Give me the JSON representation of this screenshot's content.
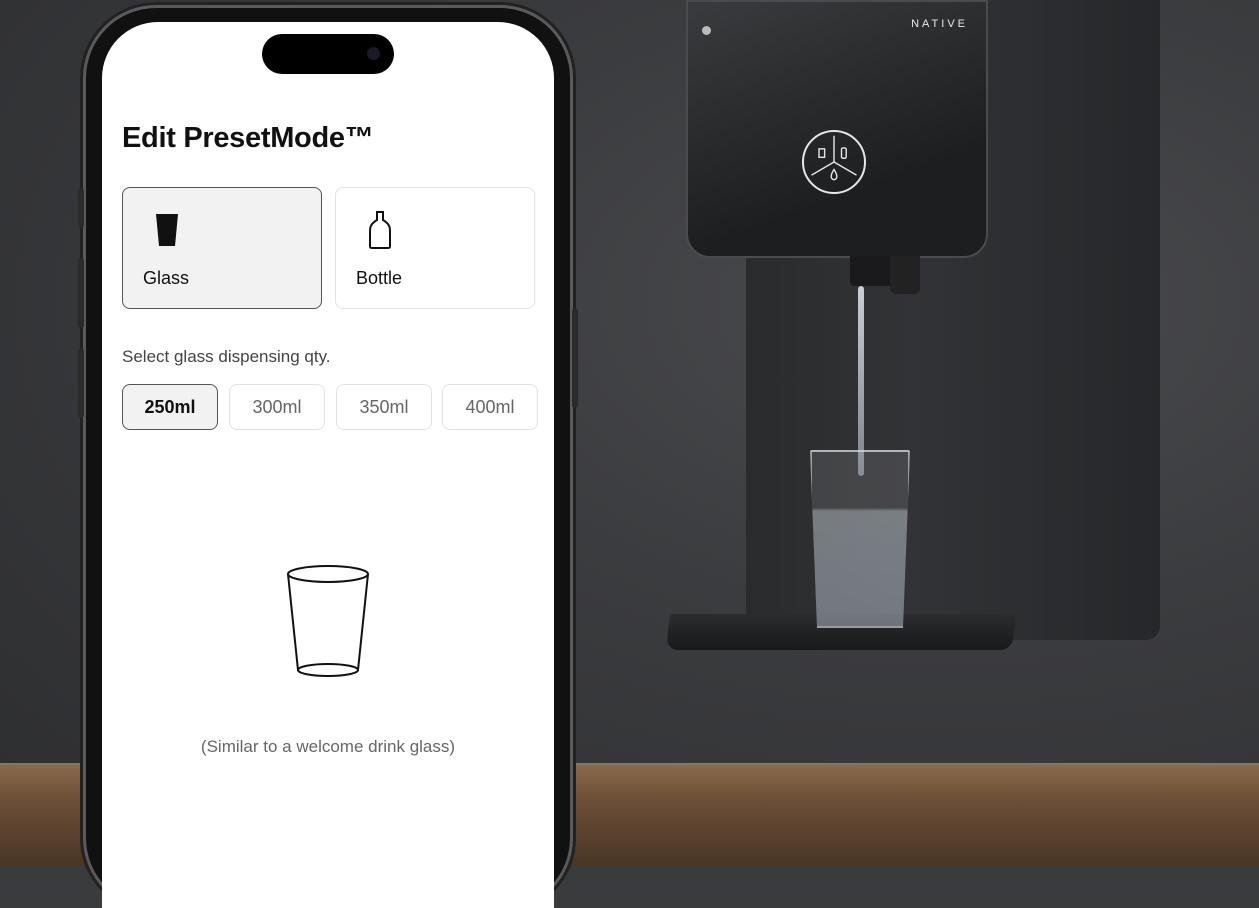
{
  "brand": "NATIVE",
  "page": {
    "title": "Edit PresetMode™"
  },
  "container_types": [
    {
      "label": "Glass",
      "icon": "glass-icon",
      "selected": true
    },
    {
      "label": "Bottle",
      "icon": "bottle-icon",
      "selected": false
    }
  ],
  "quantity": {
    "label": "Select glass dispensing qty.",
    "options": [
      "250ml",
      "300ml",
      "350ml",
      "400ml"
    ],
    "selected": "250ml"
  },
  "preview": {
    "icon": "glass-outline-icon",
    "caption": "(Similar to a welcome drink glass)"
  }
}
